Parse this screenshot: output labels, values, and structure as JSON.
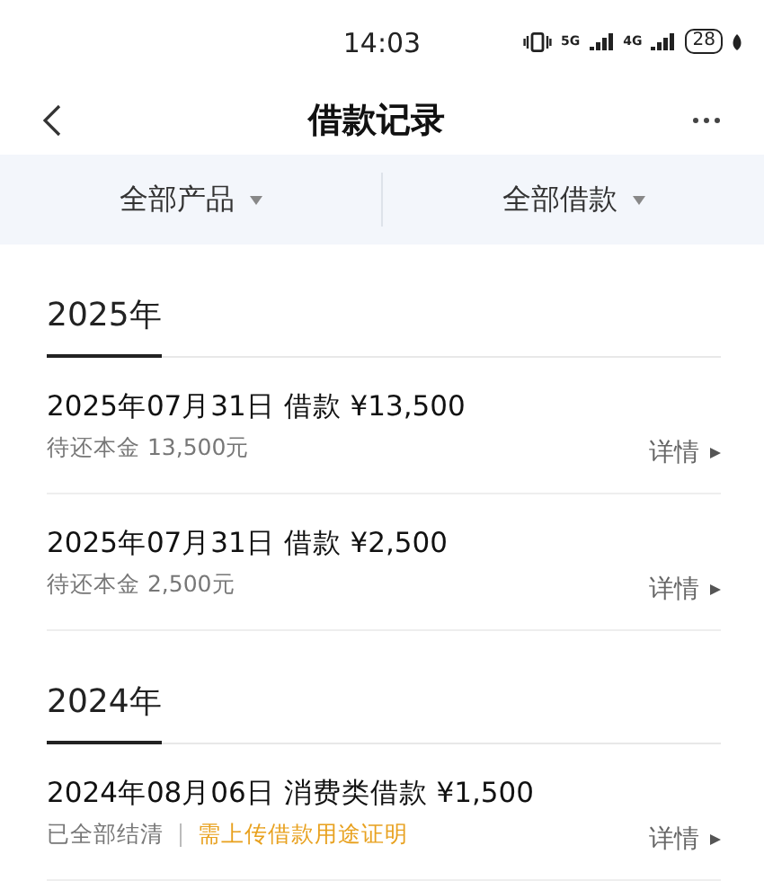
{
  "status_bar": {
    "time": "14:03",
    "network_1": "5G",
    "network_2": "4G",
    "battery": "28"
  },
  "nav": {
    "title": "借款记录"
  },
  "filters": [
    {
      "label": "全部产品"
    },
    {
      "label": "全部借款"
    }
  ],
  "groups": [
    {
      "year": "2025年",
      "records": [
        {
          "title": "2025年07月31日 借款 ¥13,500",
          "status": "待还本金 13,500元",
          "detail": "详情"
        },
        {
          "title": "2025年07月31日 借款 ¥2,500",
          "status": "待还本金 2,500元",
          "detail": "详情"
        }
      ]
    },
    {
      "year": "2024年",
      "records": [
        {
          "title": "2024年08月06日 消费类借款 ¥1,500",
          "status": "已全部结清",
          "note": "需上传借款用途证明",
          "detail": "详情"
        }
      ]
    }
  ]
}
